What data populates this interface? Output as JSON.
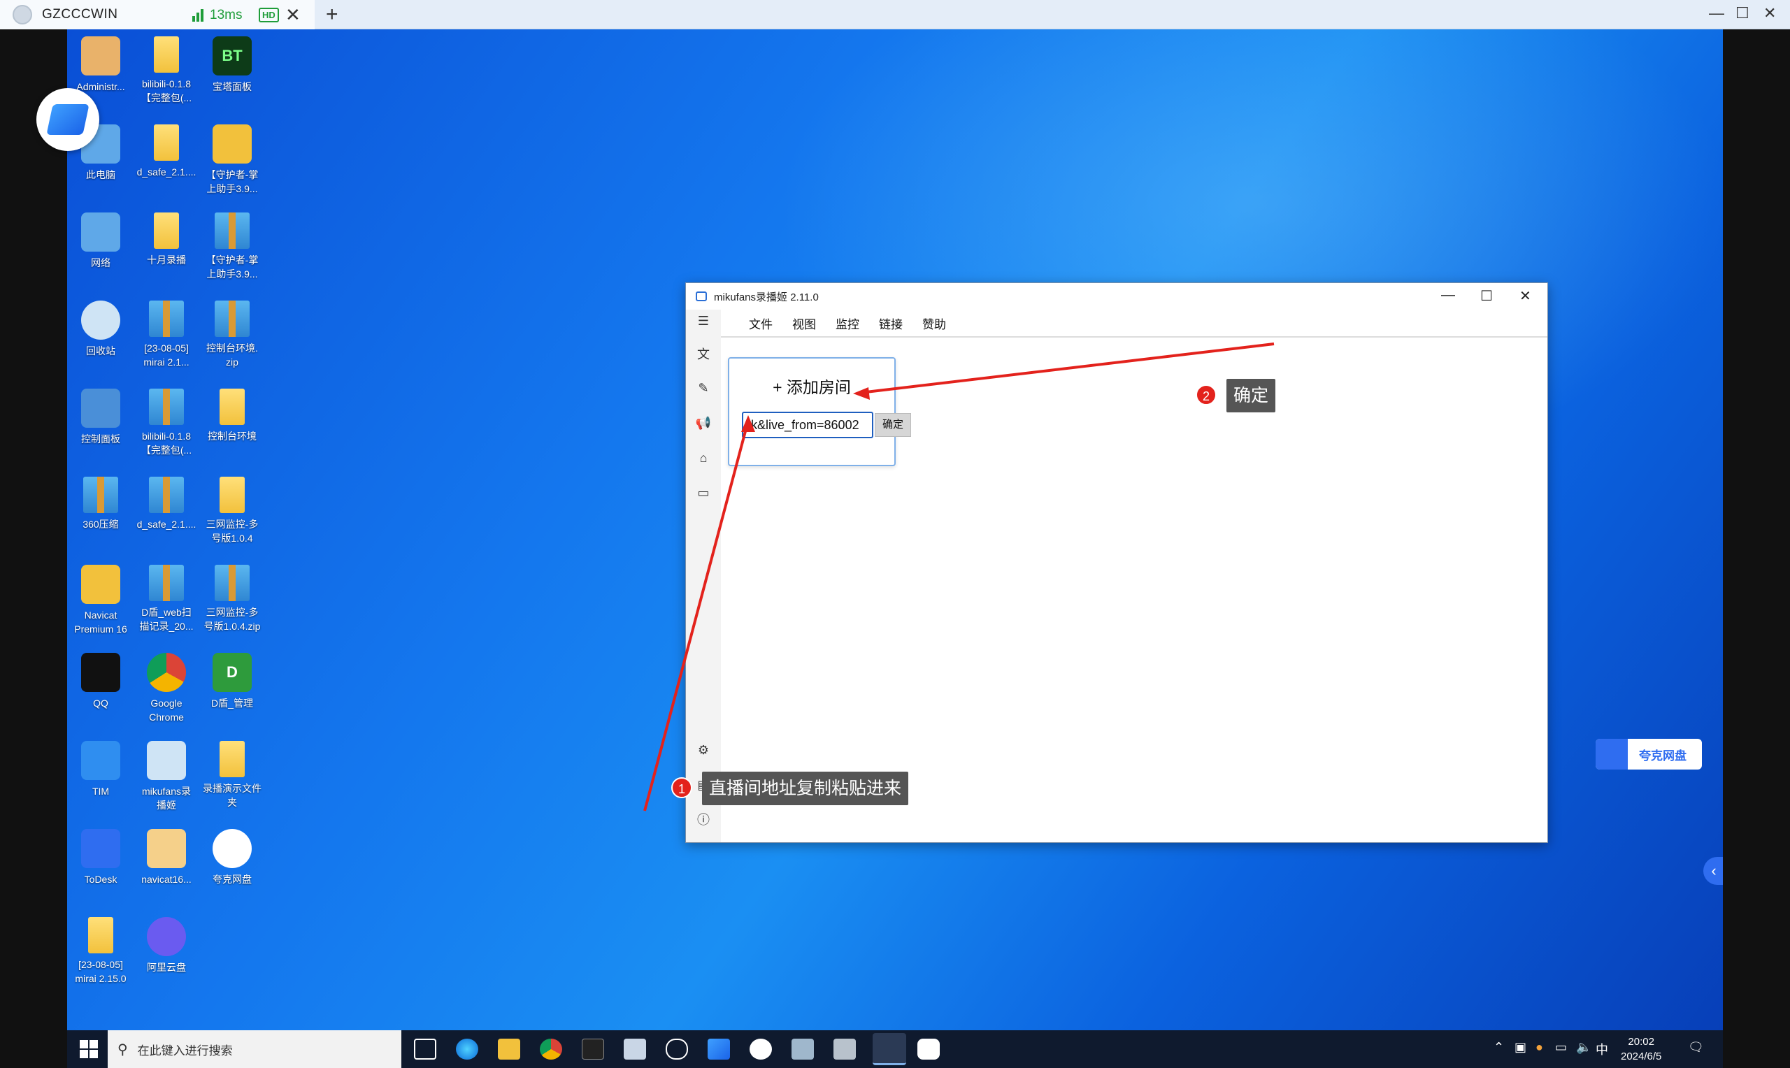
{
  "client": {
    "tab_name": "GZCCCWIN",
    "latency": "13ms",
    "quality": "HD",
    "close": "✕",
    "new_tab": "+"
  },
  "desktop_icons": [
    {
      "label": "Administr...",
      "kind": "user"
    },
    {
      "label": "bilibili-0.1.8\n【完整包(...",
      "kind": "folder"
    },
    {
      "label": "宝塔面板",
      "kind": "bt"
    },
    {
      "label": "此电脑",
      "kind": "pc"
    },
    {
      "label": "d_safe_2.1....",
      "kind": "folder"
    },
    {
      "label": "【守护者-掌\n上助手3.9...",
      "kind": "folder-app"
    },
    {
      "label": "网络",
      "kind": "network"
    },
    {
      "label": "十月录播",
      "kind": "folder"
    },
    {
      "label": "【守护者-掌\n上助手3.9...",
      "kind": "zip"
    },
    {
      "label": "回收站",
      "kind": "recycle"
    },
    {
      "label": "[23-08-05]\nmirai 2.1...",
      "kind": "zip"
    },
    {
      "label": "控制台环境.\nzip",
      "kind": "zip"
    },
    {
      "label": "控制面板",
      "kind": "control"
    },
    {
      "label": "bilibili-0.1.8\n【完整包(...",
      "kind": "zip"
    },
    {
      "label": "控制台环境",
      "kind": "folder"
    },
    {
      "label": "360压缩",
      "kind": "zip"
    },
    {
      "label": "d_safe_2.1....",
      "kind": "zip"
    },
    {
      "label": "三网监控-多\n号版1.0.4",
      "kind": "folder"
    },
    {
      "label": "Navicat\nPremium 16",
      "kind": "navicat"
    },
    {
      "label": "D盾_web扫\n描记录_20...",
      "kind": "zip"
    },
    {
      "label": "三网监控-多\n号版1.0.4.zip",
      "kind": "zip"
    },
    {
      "label": "QQ",
      "kind": "qq"
    },
    {
      "label": "Google\nChrome",
      "kind": "chrome"
    },
    {
      "label": "D盾_管理",
      "kind": "dshield"
    },
    {
      "label": "TIM",
      "kind": "tim"
    },
    {
      "label": "mikufans录\n播姬",
      "kind": "mikufans"
    },
    {
      "label": "录播演示文件\n夹",
      "kind": "folder"
    },
    {
      "label": "ToDesk",
      "kind": "todesk"
    },
    {
      "label": "navicat16...",
      "kind": "navicat2"
    },
    {
      "label": "夸克网盘",
      "kind": "quark"
    },
    {
      "label": "[23-08-05]\nmirai 2.15.0",
      "kind": "folder"
    },
    {
      "label": "阿里云盘",
      "kind": "aliyun"
    }
  ],
  "window": {
    "title": "mikufans录播姬 2.11.0",
    "menu": [
      "文件",
      "视图",
      "监控",
      "链接",
      "赞助"
    ],
    "add_room": {
      "title": "+ 添加房间",
      "input_value": ":k&live_from=86002",
      "confirm": "确定"
    }
  },
  "annotations": [
    {
      "num": "1",
      "text": "直播间地址复制粘贴进来"
    },
    {
      "num": "2",
      "text": "确定"
    }
  ],
  "quark_widget": {
    "label": "夸克网盘"
  },
  "taskbar": {
    "search_placeholder": "在此键入进行搜索",
    "ime": "中",
    "time": "20:02",
    "date": "2024/6/5"
  }
}
